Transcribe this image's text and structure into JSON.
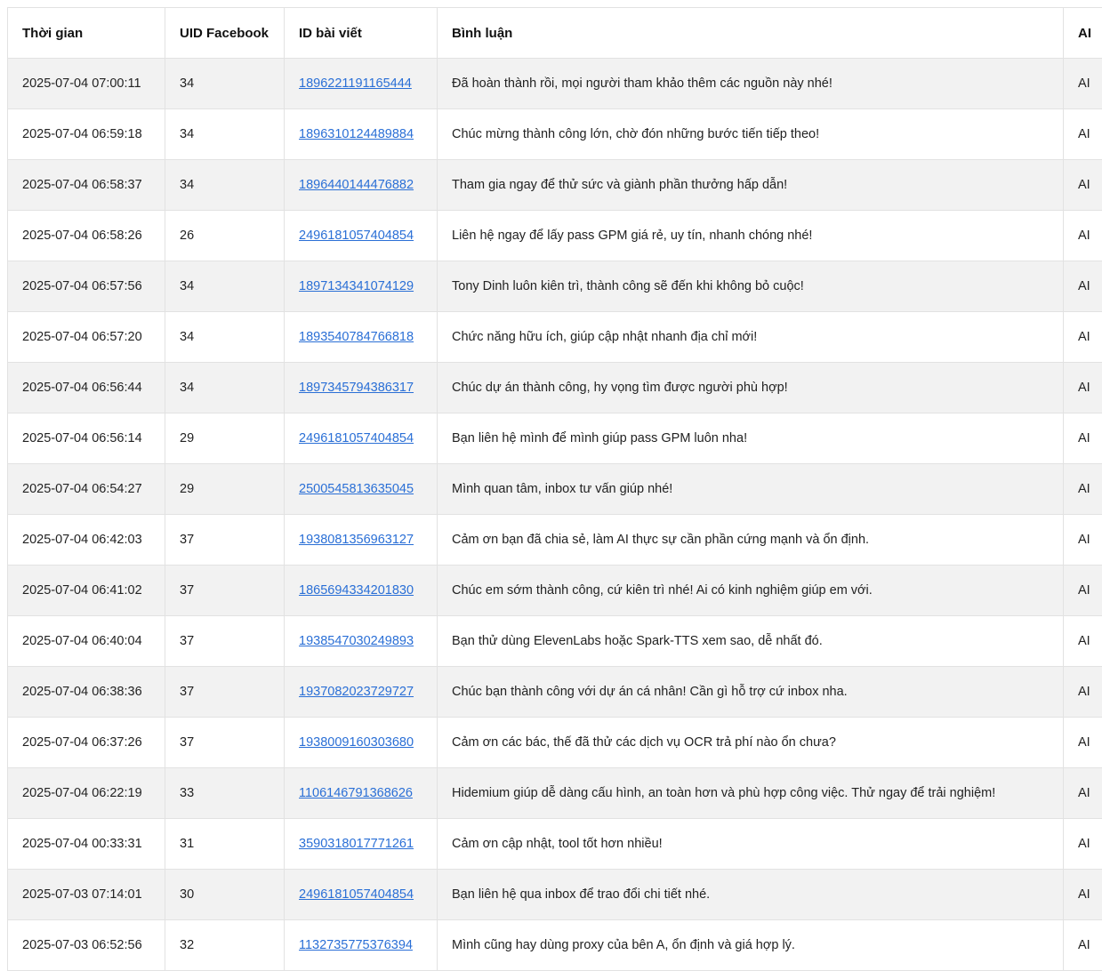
{
  "table": {
    "headers": [
      "Thời gian",
      "UID Facebook",
      "ID bài viết",
      "Bình luận",
      "AI"
    ],
    "rows": [
      {
        "time": "2025-07-04 07:00:11",
        "uid": "34",
        "post_id": "1896221191165444",
        "comment": "Đã hoàn thành rồi, mọi người tham khảo thêm các nguồn này nhé!",
        "ai": "AI"
      },
      {
        "time": "2025-07-04 06:59:18",
        "uid": "34",
        "post_id": "1896310124489884",
        "comment": "Chúc mừng thành công lớn, chờ đón những bước tiến tiếp theo!",
        "ai": "AI"
      },
      {
        "time": "2025-07-04 06:58:37",
        "uid": "34",
        "post_id": "1896440144476882",
        "comment": "Tham gia ngay để thử sức và giành phần thưởng hấp dẫn!",
        "ai": "AI"
      },
      {
        "time": "2025-07-04 06:58:26",
        "uid": "26",
        "post_id": "2496181057404854",
        "comment": "Liên hệ ngay để lấy pass GPM giá rẻ, uy tín, nhanh chóng nhé!",
        "ai": "AI"
      },
      {
        "time": "2025-07-04 06:57:56",
        "uid": "34",
        "post_id": "1897134341074129",
        "comment": "Tony Dinh luôn kiên trì, thành công sẽ đến khi không bỏ cuộc!",
        "ai": "AI"
      },
      {
        "time": "2025-07-04 06:57:20",
        "uid": "34",
        "post_id": "1893540784766818",
        "comment": "Chức năng hữu ích, giúp cập nhật nhanh địa chỉ mới!",
        "ai": "AI"
      },
      {
        "time": "2025-07-04 06:56:44",
        "uid": "34",
        "post_id": "1897345794386317",
        "comment": "Chúc dự án thành công, hy vọng tìm được người phù hợp!",
        "ai": "AI"
      },
      {
        "time": "2025-07-04 06:56:14",
        "uid": "29",
        "post_id": "2496181057404854",
        "comment": "Bạn liên hệ mình để mình giúp pass GPM luôn nha!",
        "ai": "AI"
      },
      {
        "time": "2025-07-04 06:54:27",
        "uid": "29",
        "post_id": "2500545813635045",
        "comment": "Mình quan tâm, inbox tư vấn giúp nhé!",
        "ai": "AI"
      },
      {
        "time": "2025-07-04 06:42:03",
        "uid": "37",
        "post_id": "1938081356963127",
        "comment": "Cảm ơn bạn đã chia sẻ, làm AI thực sự cần phần cứng mạnh và ổn định.",
        "ai": "AI"
      },
      {
        "time": "2025-07-04 06:41:02",
        "uid": "37",
        "post_id": "1865694334201830",
        "comment": "Chúc em sớm thành công, cứ kiên trì nhé! Ai có kinh nghiệm giúp em với.",
        "ai": "AI"
      },
      {
        "time": "2025-07-04 06:40:04",
        "uid": "37",
        "post_id": "1938547030249893",
        "comment": "Bạn thử dùng ElevenLabs hoặc Spark-TTS xem sao, dễ nhất đó.",
        "ai": "AI"
      },
      {
        "time": "2025-07-04 06:38:36",
        "uid": "37",
        "post_id": "1937082023729727",
        "comment": "Chúc bạn thành công với dự án cá nhân! Cần gì hỗ trợ cứ inbox nha.",
        "ai": "AI"
      },
      {
        "time": "2025-07-04 06:37:26",
        "uid": "37",
        "post_id": "1938009160303680",
        "comment": "Cảm ơn các bác, thế đã thử các dịch vụ OCR trả phí nào ổn chưa?",
        "ai": "AI"
      },
      {
        "time": "2025-07-04 06:22:19",
        "uid": "33",
        "post_id": "1106146791368626",
        "comment": "Hidemium giúp dễ dàng cấu hình, an toàn hơn và phù hợp công việc. Thử ngay để trải nghiệm!",
        "ai": "AI"
      },
      {
        "time": "2025-07-04 00:33:31",
        "uid": "31",
        "post_id": "3590318017771261",
        "comment": "Cảm ơn cập nhật, tool tốt hơn nhiều!",
        "ai": "AI"
      },
      {
        "time": "2025-07-03 07:14:01",
        "uid": "30",
        "post_id": "2496181057404854",
        "comment": "Bạn liên hệ qua inbox để trao đổi chi tiết nhé.",
        "ai": "AI"
      },
      {
        "time": "2025-07-03 06:52:56",
        "uid": "32",
        "post_id": "1132735775376394",
        "comment": "Mình cũng hay dùng proxy của bên A, ổn định và giá hợp lý.",
        "ai": "AI"
      }
    ]
  }
}
